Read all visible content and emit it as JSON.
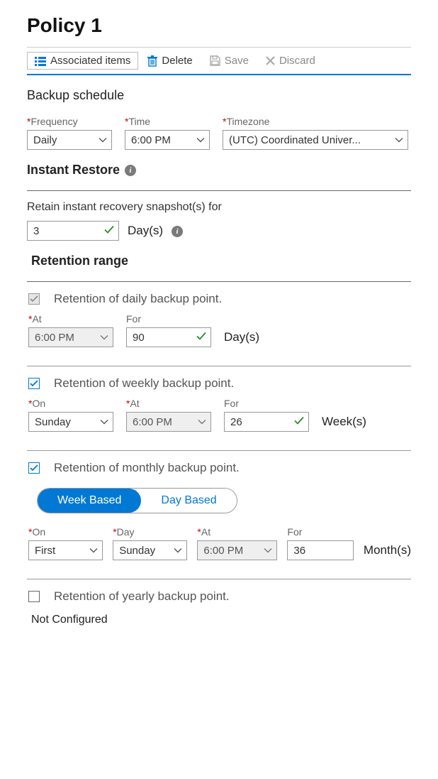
{
  "title": "Policy 1",
  "toolbar": {
    "associated": "Associated items",
    "delete": "Delete",
    "save": "Save",
    "discard": "Discard"
  },
  "schedule": {
    "heading": "Backup schedule",
    "frequency_label": "Frequency",
    "frequency_value": "Daily",
    "time_label": "Time",
    "time_value": "6:00 PM",
    "tz_label": "Timezone",
    "tz_value": "(UTC) Coordinated Univer..."
  },
  "instant": {
    "heading": "Instant Restore",
    "retain_label": "Retain instant recovery snapshot(s) for",
    "value": "3",
    "unit": "Day(s)"
  },
  "retention": {
    "heading": "Retention range",
    "daily": {
      "title": "Retention of daily backup point.",
      "at_label": "At",
      "at_value": "6:00 PM",
      "for_label": "For",
      "for_value": "90",
      "unit": "Day(s)"
    },
    "weekly": {
      "title": "Retention of weekly backup point.",
      "on_label": "On",
      "on_value": "Sunday",
      "at_label": "At",
      "at_value": "6:00 PM",
      "for_label": "For",
      "for_value": "26",
      "unit": "Week(s)"
    },
    "monthly": {
      "title": "Retention of monthly backup point.",
      "week_based": "Week Based",
      "day_based": "Day Based",
      "on_label": "On",
      "on_value": "First",
      "day_label": "Day",
      "day_value": "Sunday",
      "at_label": "At",
      "at_value": "6:00 PM",
      "for_label": "For",
      "for_value": "36",
      "unit": "Month(s)"
    },
    "yearly": {
      "title": "Retention of yearly backup point.",
      "not_configured": "Not Configured"
    }
  }
}
